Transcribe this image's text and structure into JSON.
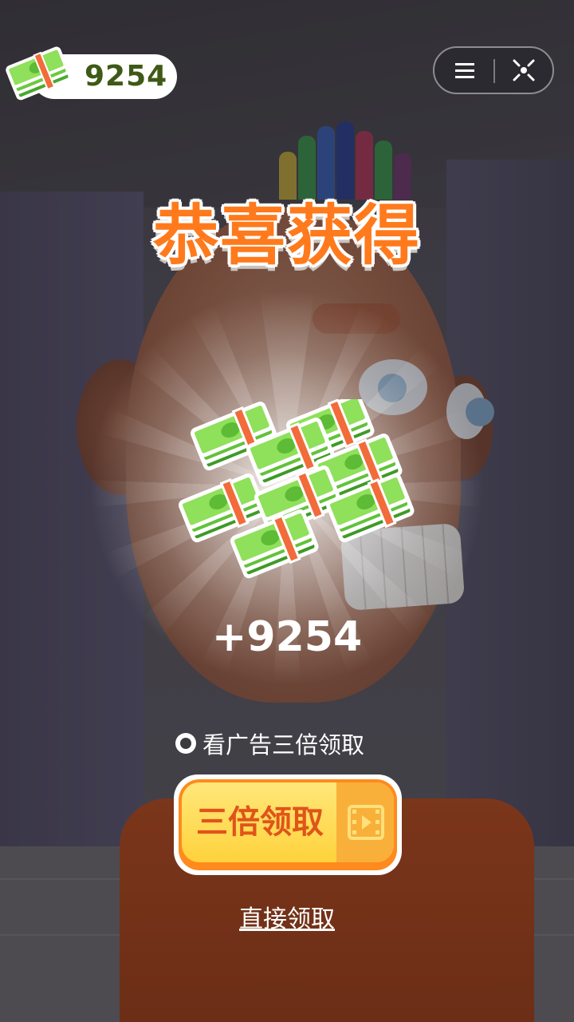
{
  "hud": {
    "coins": "9254",
    "cash_icon": "cash-stack-icon",
    "menu_icon": "menu-icon",
    "close_icon": "close-target-icon"
  },
  "title": "恭喜获得",
  "reward": {
    "icon": "cash-pile-icon",
    "amount": "+9254"
  },
  "ad_option": {
    "label": "看广告三倍领取",
    "selected": true
  },
  "triple_button": {
    "label": "三倍领取",
    "icon": "video-icon"
  },
  "direct_claim": "直接领取",
  "colors": {
    "title": "#ff7a1c",
    "button_face": "#ffd23c",
    "button_text": "#e0541a",
    "cash_green": "#7ed957",
    "coin_text": "#3e5a16"
  }
}
